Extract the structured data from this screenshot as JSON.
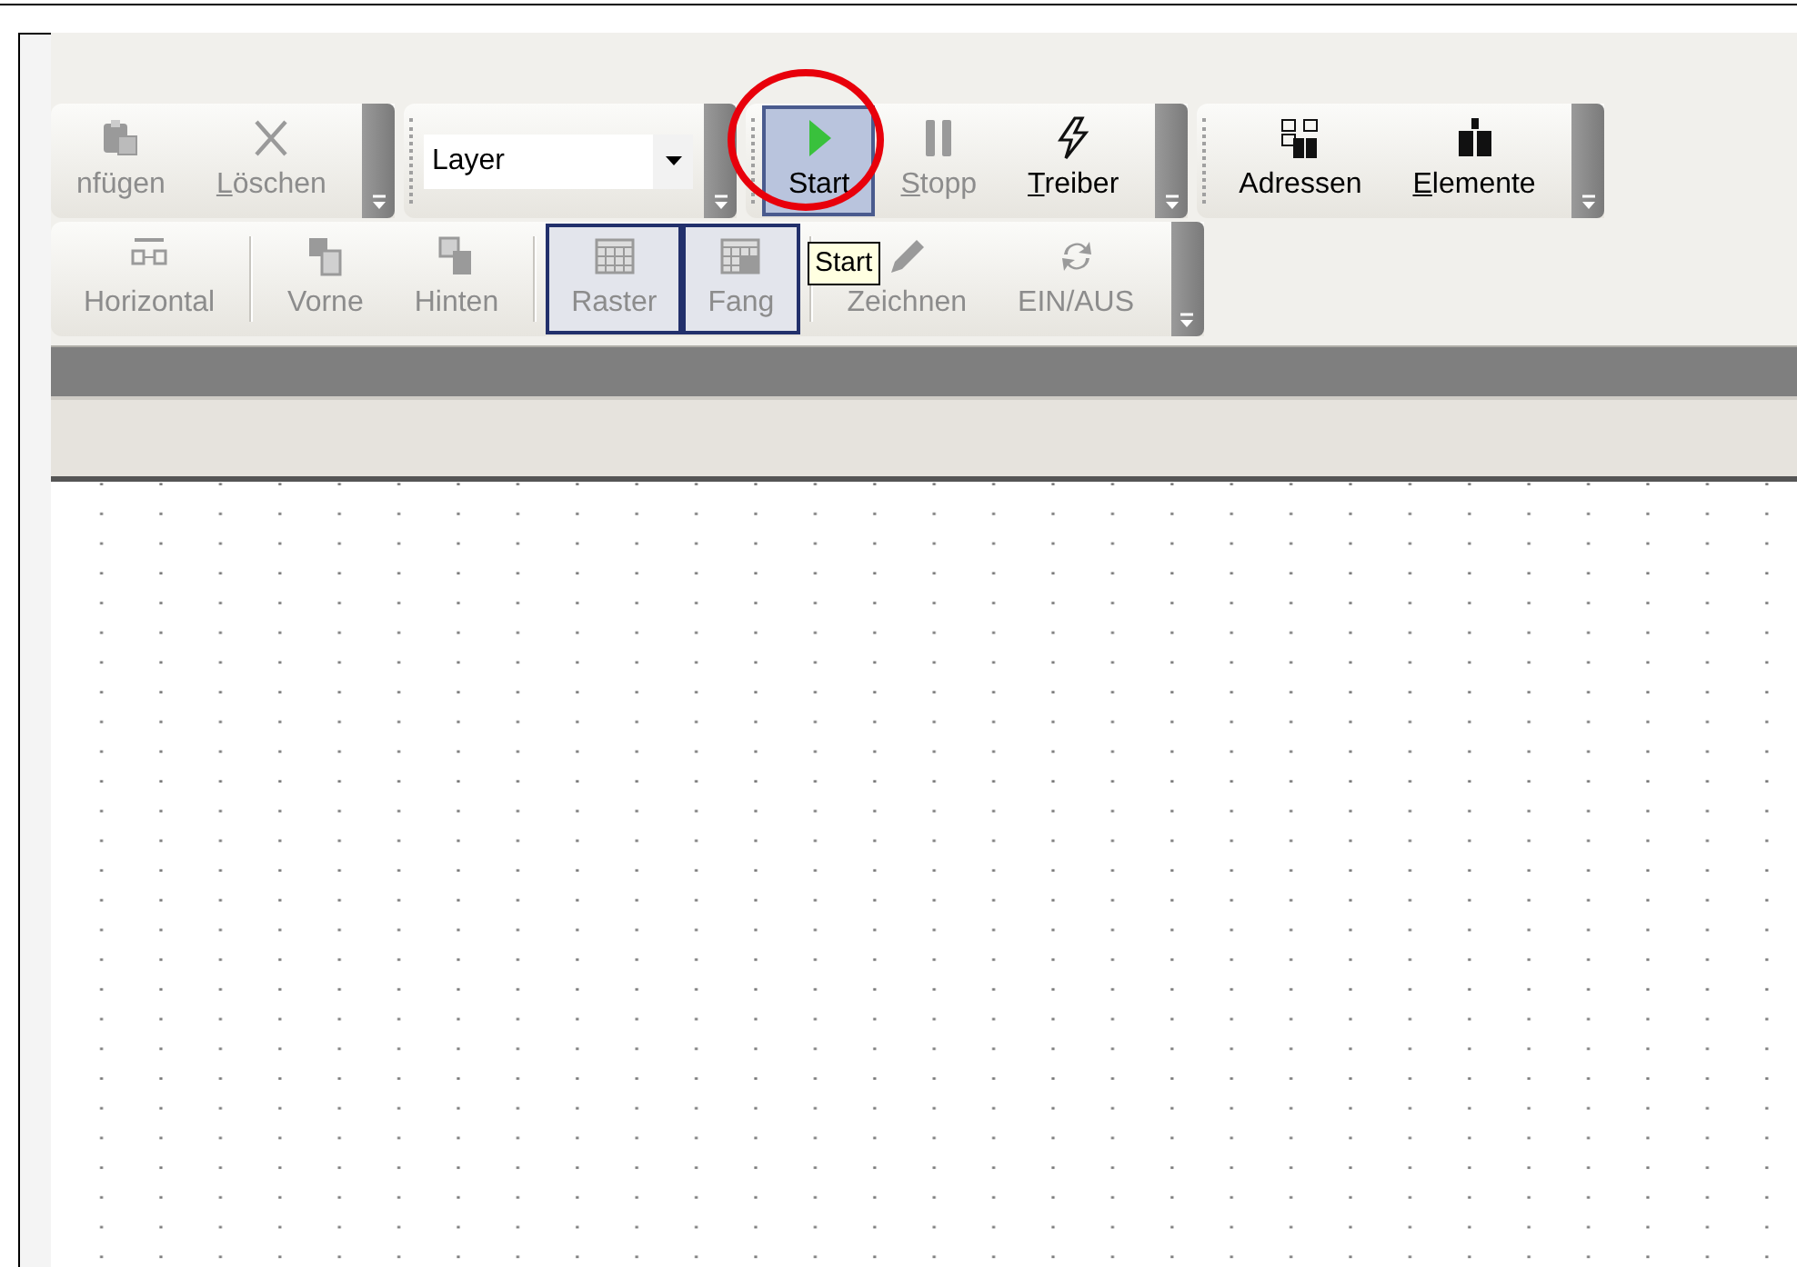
{
  "toolbar_rows": [
    {
      "toolbars": [
        {
          "items": [
            {
              "kind": "button",
              "label": "nfügen",
              "disabled": true,
              "mnemonic": false,
              "hovered": false,
              "checked": false
            },
            {
              "kind": "button",
              "label": "Löschen",
              "disabled": true,
              "mnemonic": true,
              "hovered": false,
              "checked": false
            }
          ]
        },
        {
          "items": [
            {
              "kind": "combobox",
              "value": "Layer"
            }
          ]
        },
        {
          "items": [
            {
              "kind": "button",
              "label": "Start",
              "disabled": false,
              "mnemonic": false,
              "hovered": true,
              "checked": false
            },
            {
              "kind": "button",
              "label": "Stopp",
              "disabled": true,
              "mnemonic": true,
              "hovered": false,
              "checked": false
            },
            {
              "kind": "button",
              "label": "Treiber",
              "disabled": false,
              "mnemonic": true,
              "hovered": false,
              "checked": false
            }
          ]
        },
        {
          "items": [
            {
              "kind": "button",
              "label": "Adressen",
              "disabled": false,
              "mnemonic": false,
              "hovered": false,
              "checked": false
            },
            {
              "kind": "button",
              "label": "Elemente",
              "disabled": false,
              "mnemonic": true,
              "hovered": false,
              "checked": false
            }
          ]
        }
      ]
    },
    {
      "toolbars": [
        {
          "items": [
            {
              "kind": "button",
              "label": "Horizontal",
              "disabled": true,
              "mnemonic": false,
              "hovered": false,
              "checked": false
            },
            {
              "kind": "separator"
            },
            {
              "kind": "button",
              "label": "Vorne",
              "disabled": true,
              "mnemonic": false,
              "hovered": false,
              "checked": false
            },
            {
              "kind": "button",
              "label": "Hinten",
              "disabled": true,
              "mnemonic": false,
              "hovered": false,
              "checked": false
            },
            {
              "kind": "separator"
            },
            {
              "kind": "button",
              "label": "Raster",
              "disabled": true,
              "mnemonic": false,
              "hovered": false,
              "checked": true
            },
            {
              "kind": "button",
              "label": "Fang",
              "disabled": true,
              "mnemonic": false,
              "hovered": false,
              "checked": true
            },
            {
              "kind": "separator"
            },
            {
              "kind": "button",
              "label": "Zeichnen",
              "disabled": true,
              "mnemonic": false,
              "hovered": false,
              "checked": false
            },
            {
              "kind": "button",
              "label": "EIN/AUS",
              "disabled": true,
              "mnemonic": false,
              "hovered": false,
              "checked": false
            }
          ]
        }
      ]
    }
  ],
  "tooltip": {
    "text": "Start"
  }
}
